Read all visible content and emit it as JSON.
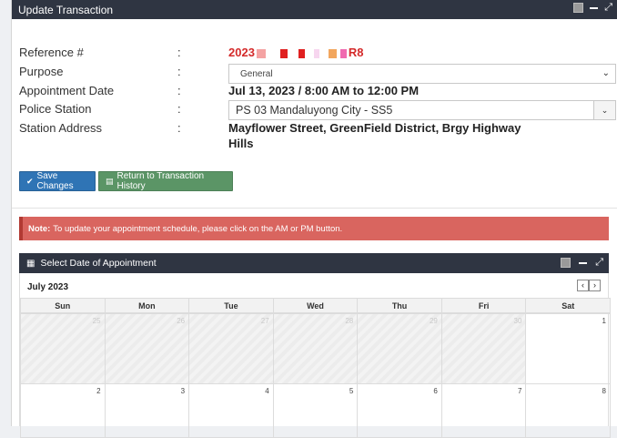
{
  "window": {
    "title": "Update Transaction"
  },
  "form": {
    "reference": {
      "label": "Reference #",
      "value_prefix": "2023",
      "value_suffix": "R8"
    },
    "purpose": {
      "label": "Purpose",
      "selected": "General"
    },
    "appointment_date": {
      "label": "Appointment Date",
      "value": "Jul 13, 2023 / 8:00 AM to 12:00 PM"
    },
    "police_station": {
      "label": "Police Station",
      "selected": "PS 03 Mandaluyong City - SS5"
    },
    "station_address": {
      "label": "Station Address",
      "value_line1": "Mayflower Street, GreenField District, Brgy Highway",
      "value_line2": "Hills"
    },
    "colon": ":"
  },
  "buttons": {
    "save_label": "Save Changes",
    "return_label": "Return to Transaction History"
  },
  "note": {
    "bold": "Note:",
    "text": "To update your appointment schedule, please click on the AM or PM button."
  },
  "calendar": {
    "header_title": "Select Date of Appointment",
    "month_label": "July 2023",
    "weekdays": [
      "Sun",
      "Mon",
      "Tue",
      "Wed",
      "Thu",
      "Fri",
      "Sat"
    ],
    "week1": [
      "25",
      "26",
      "27",
      "28",
      "29",
      "30",
      "1"
    ],
    "week2": [
      "2",
      "3",
      "4",
      "5",
      "6",
      "7",
      "8"
    ]
  },
  "colors": {
    "titlebar": "#2f3542",
    "save": "#2f74b5",
    "return": "#5b9566",
    "note": "#d9655f",
    "reference": "#d42a2a"
  }
}
